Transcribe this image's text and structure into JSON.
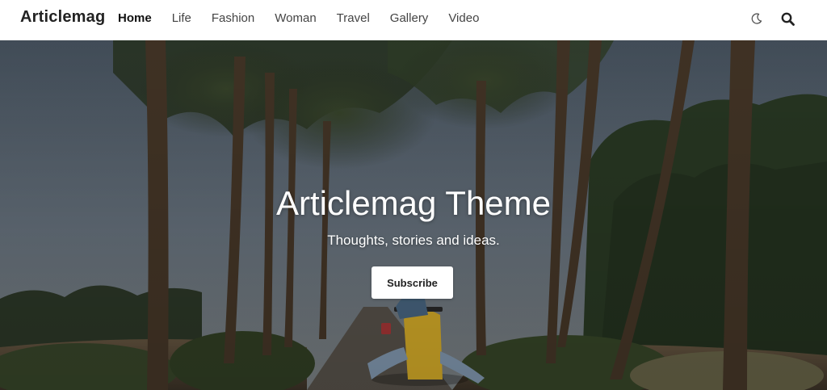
{
  "header": {
    "logo": "Articlemag",
    "nav": [
      {
        "label": "Home",
        "active": true
      },
      {
        "label": "Life",
        "active": false
      },
      {
        "label": "Fashion",
        "active": false
      },
      {
        "label": "Woman",
        "active": false
      },
      {
        "label": "Travel",
        "active": false
      },
      {
        "label": "Gallery",
        "active": false
      },
      {
        "label": "Video",
        "active": false
      }
    ],
    "icons": [
      "moon-icon",
      "search-icon"
    ]
  },
  "hero": {
    "title": "Articlemag Theme",
    "tagline": "Thoughts, stories and ideas.",
    "subscribe_label": "Subscribe",
    "image": "palm-tree road with scooter riders"
  },
  "colors": {
    "header_bg": "#ffffff",
    "text_dark": "#222222",
    "hero_text": "#ffffff",
    "button_bg": "#ffffff"
  }
}
